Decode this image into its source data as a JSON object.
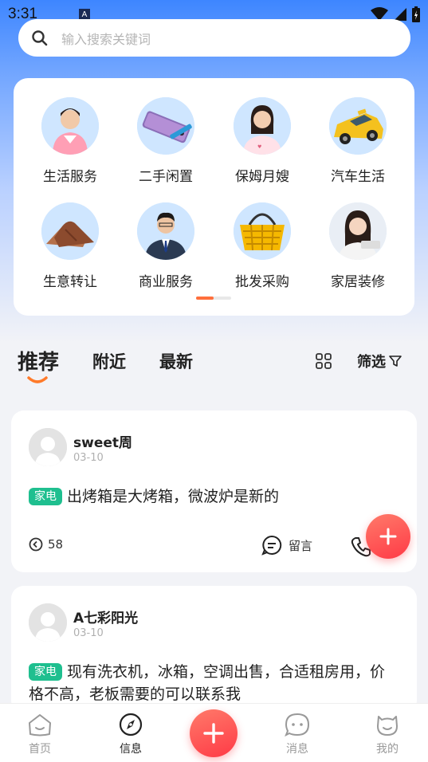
{
  "status_bar": {
    "time": "3:31",
    "indicator": "A"
  },
  "search": {
    "placeholder": "输入搜索关键词"
  },
  "categories": [
    {
      "label": "生活服务",
      "icon": "service-woman-icon"
    },
    {
      "label": "二手闲置",
      "icon": "phone-device-icon"
    },
    {
      "label": "保姆月嫂",
      "icon": "nanny-woman-icon"
    },
    {
      "label": "汽车生活",
      "icon": "car-icon"
    },
    {
      "label": "生意转让",
      "icon": "handshake-icon"
    },
    {
      "label": "商业服务",
      "icon": "businessman-icon"
    },
    {
      "label": "批发采购",
      "icon": "basket-icon"
    },
    {
      "label": "家居装修",
      "icon": "home-woman-icon"
    }
  ],
  "tabs": [
    {
      "label": "推荐",
      "active": true
    },
    {
      "label": "附近",
      "active": false
    },
    {
      "label": "最新",
      "active": false
    }
  ],
  "filter_label": "筛选",
  "posts": [
    {
      "name": "sweet周",
      "date": "03-10",
      "tag": "家电",
      "text": "出烤箱是大烤箱，微波炉是新的",
      "views": "58",
      "comment_label": "留言"
    },
    {
      "name": "A七彩阳光",
      "date": "03-10",
      "tag": "家电",
      "text": "现有洗衣机，冰箱，空调出售，合适租房用，价格不高，老板需要的可以联系我"
    }
  ],
  "bottom_nav": [
    {
      "label": "首页",
      "icon": "home-icon",
      "active": false
    },
    {
      "label": "信息",
      "icon": "compass-icon",
      "active": true
    },
    {
      "label": "消息",
      "icon": "message-icon",
      "active": false
    },
    {
      "label": "我的",
      "icon": "profile-icon",
      "active": false
    }
  ],
  "colors": {
    "accent": "#ff3a46",
    "tag": "#1fbf8f",
    "indicator": "#ff6f3c"
  }
}
